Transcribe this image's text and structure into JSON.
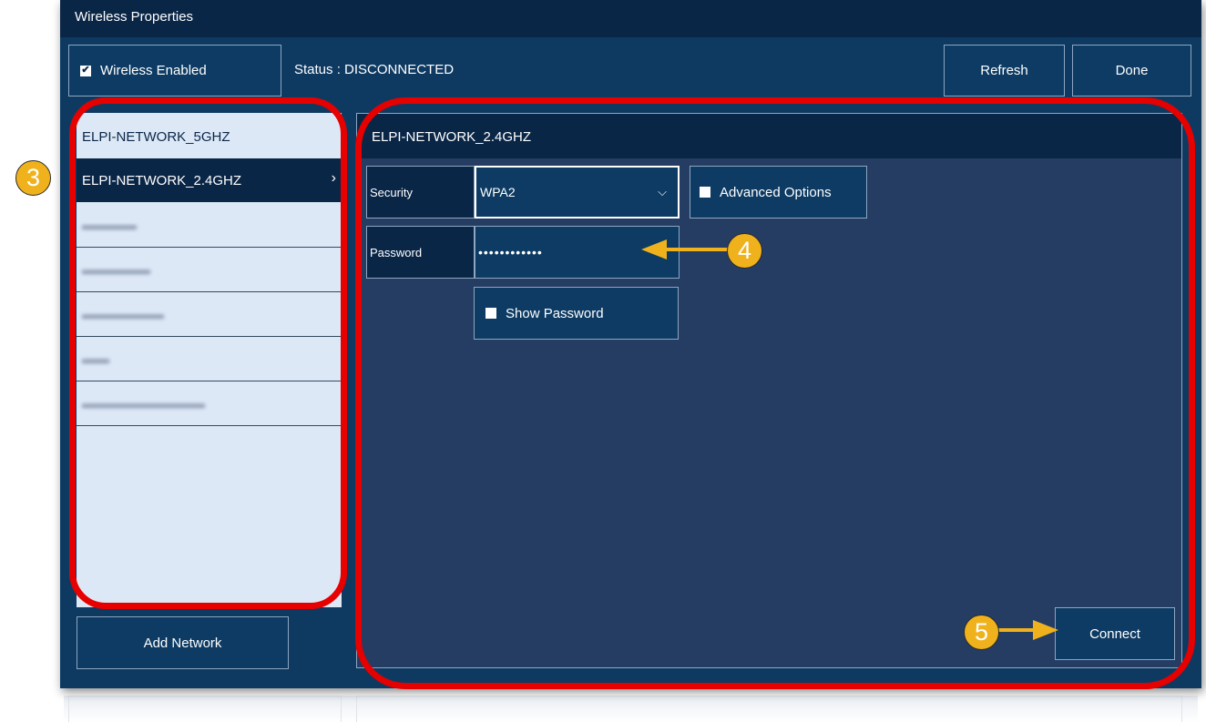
{
  "window": {
    "title": "Wireless Properties"
  },
  "toolbar": {
    "wireless_enabled_label": "Wireless Enabled",
    "wireless_enabled_checked": true,
    "status_text": "Status : DISCONNECTED",
    "refresh_label": "Refresh",
    "done_label": "Done"
  },
  "networks": [
    {
      "ssid": "ELPI-NETWORK_5GHZ",
      "selected": false,
      "obscured": false
    },
    {
      "ssid": "ELPI-NETWORK_2.4GHZ",
      "selected": true,
      "obscured": false
    },
    {
      "ssid": "",
      "selected": false,
      "obscured": true
    },
    {
      "ssid": "",
      "selected": false,
      "obscured": true
    },
    {
      "ssid": "",
      "selected": false,
      "obscured": true
    },
    {
      "ssid": "",
      "selected": false,
      "obscured": true
    },
    {
      "ssid": "",
      "selected": false,
      "obscured": true
    }
  ],
  "add_network_label": "Add Network",
  "detail": {
    "network_name": "ELPI-NETWORK_2.4GHZ",
    "security_label": "Security",
    "security_value": "WPA2",
    "advanced_options_label": "Advanced Options",
    "advanced_options_checked": false,
    "password_label": "Password",
    "password_masked": "••••••••••••",
    "show_password_label": "Show Password",
    "show_password_checked": false,
    "connect_label": "Connect"
  },
  "annotations": {
    "badge_3": "3",
    "badge_4": "4",
    "badge_5": "5",
    "ring_color": "#e60000",
    "badge_color": "#f0b21c",
    "arrow_color": "#f0b21c"
  }
}
